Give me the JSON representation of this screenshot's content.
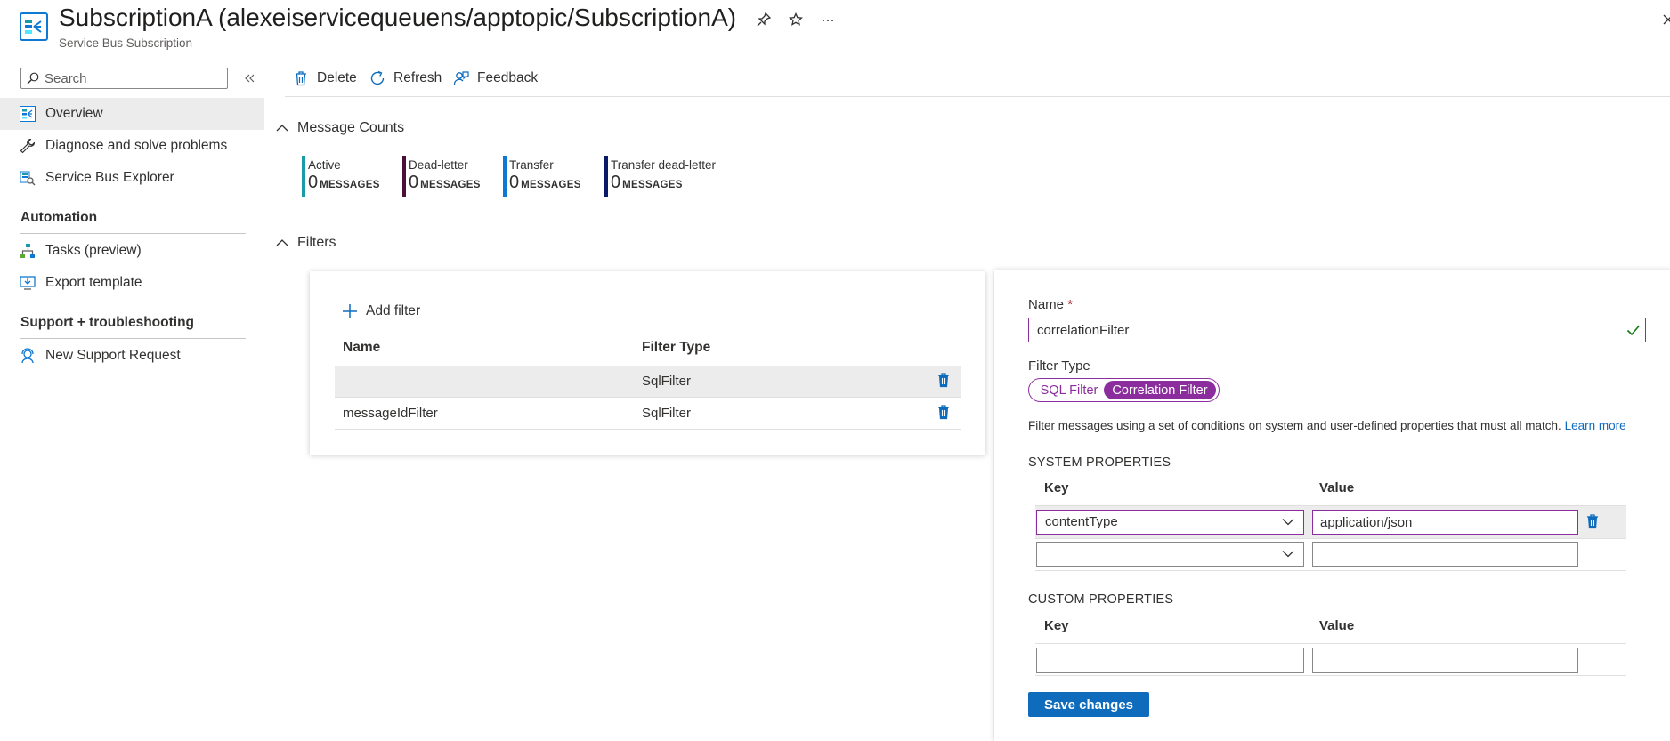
{
  "header": {
    "title": "SubscriptionA (alexeiservicequeuens/apptopic/SubscriptionA)",
    "subtitle": "Service Bus Subscription",
    "pin_icon": "pin-icon",
    "favorite_icon": "star-icon",
    "more_icon": "ellipsis-icon",
    "close_icon": "close-icon"
  },
  "sidebar": {
    "search_placeholder": "Search",
    "collapse_icon": "double-chevron-left-icon",
    "items": [
      {
        "label": "Overview",
        "icon": "service-bus-icon",
        "selected": true
      },
      {
        "label": "Diagnose and solve problems",
        "icon": "wrench-icon"
      },
      {
        "label": "Service Bus Explorer",
        "icon": "explorer-icon"
      }
    ],
    "sections": [
      {
        "title": "Automation",
        "items": [
          {
            "label": "Tasks (preview)",
            "icon": "tasks-icon"
          },
          {
            "label": "Export template",
            "icon": "export-icon"
          }
        ]
      },
      {
        "title": "Support + troubleshooting",
        "items": [
          {
            "label": "New Support Request",
            "icon": "support-icon"
          }
        ]
      }
    ]
  },
  "toolbar": {
    "delete_label": "Delete",
    "refresh_label": "Refresh",
    "feedback_label": "Feedback"
  },
  "message_counts": {
    "title": "Message Counts",
    "metrics": [
      {
        "label": "Active",
        "value": "0",
        "unit": "MESSAGES",
        "color": "#1b9aaa"
      },
      {
        "label": "Dead-letter",
        "value": "0",
        "unit": "MESSAGES",
        "color": "#4b0f3c"
      },
      {
        "label": "Transfer",
        "value": "0",
        "unit": "MESSAGES",
        "color": "#0f78d4"
      },
      {
        "label": "Transfer dead-letter",
        "value": "0",
        "unit": "MESSAGES",
        "color": "#0a1a6b"
      }
    ]
  },
  "filters": {
    "title": "Filters",
    "add_label": "Add filter",
    "columns": [
      "Name",
      "Filter Type"
    ],
    "rows": [
      {
        "name": "",
        "type": "SqlFilter",
        "selected": true
      },
      {
        "name": "messageIdFilter",
        "type": "SqlFilter"
      }
    ]
  },
  "edit": {
    "name_label": "Name",
    "required_mark": "*",
    "name_value": "correlationFilter",
    "filter_type_label": "Filter Type",
    "options": [
      "SQL Filter",
      "Correlation Filter"
    ],
    "selected_option": "Correlation Filter",
    "description": "Filter messages using a set of conditions on system and user-defined properties that must all match.",
    "learn_more": "Learn more",
    "system_title": "SYSTEM PROPERTIES",
    "custom_title": "CUSTOM PROPERTIES",
    "key_label": "Key",
    "value_label": "Value",
    "system_rows": [
      {
        "key": "contentType",
        "value": "application/json"
      },
      {
        "key": "",
        "value": ""
      }
    ],
    "custom_rows": [
      {
        "key": "",
        "value": ""
      }
    ],
    "save_label": "Save changes"
  },
  "colors": {
    "accent": "#8c2d9e",
    "primary_button": "#0f6cbd",
    "link": "#0f6cbd",
    "valid_check": "#107c10",
    "delete_icon": "#0f6cbd"
  }
}
